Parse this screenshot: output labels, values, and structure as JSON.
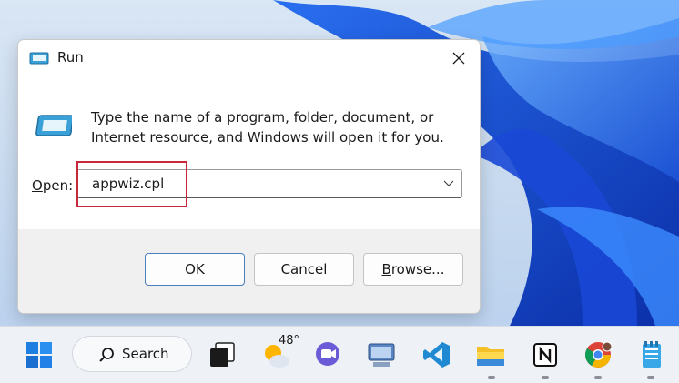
{
  "dialog": {
    "title": "Run",
    "description": "Type the name of a program, folder, document, or Internet resource, and Windows will open it for you.",
    "open_label_prefix": "",
    "open_label_accel": "O",
    "open_label_rest": "pen:",
    "open_value": "appwiz.cpl",
    "ok_label": "OK",
    "cancel_label": "Cancel",
    "browse_accel": "B",
    "browse_rest": "rowse...",
    "highlight_color": "#c62839"
  },
  "taskbar": {
    "search_label": "Search",
    "weather_temp": "48°",
    "items": [
      "start-icon",
      "search",
      "task-view-icon",
      "weather-icon",
      "meet-icon",
      "monitor-icon",
      "vscode-icon",
      "file-explorer-icon",
      "notion-icon",
      "chrome-icon",
      "notepad-icon"
    ]
  }
}
